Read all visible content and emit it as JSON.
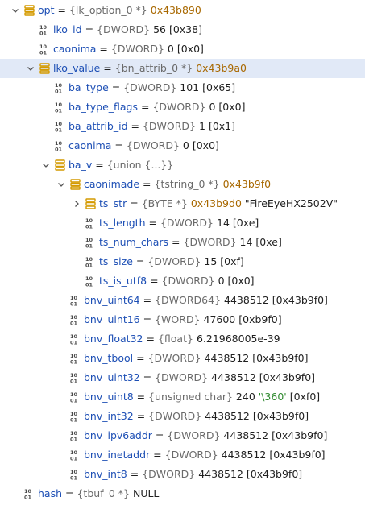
{
  "rows": [
    {
      "id": "opt",
      "name": "opt",
      "type": "{lk_option_0 *}",
      "value": "0x43b890",
      "kind": "struct",
      "expand": "down",
      "value_class": "addr"
    },
    {
      "id": "lko_id",
      "name": "lko_id",
      "type": "{DWORD}",
      "value": "56",
      "hex": "[0x38]",
      "kind": "field"
    },
    {
      "id": "caonima1",
      "name": "caonima",
      "type": "{DWORD}",
      "value": "0",
      "hex": "[0x0]",
      "kind": "field"
    },
    {
      "id": "lko_value",
      "name": "lko_value",
      "type": "{bn_attrib_0 *}",
      "value": "0x43b9a0",
      "kind": "struct",
      "expand": "down",
      "value_class": "addr",
      "selected": true
    },
    {
      "id": "ba_type",
      "name": "ba_type",
      "type": "{DWORD}",
      "value": "101",
      "hex": "[0x65]",
      "kind": "field"
    },
    {
      "id": "ba_type_flags",
      "name": "ba_type_flags",
      "type": "{DWORD}",
      "value": "0",
      "hex": "[0x0]",
      "kind": "field"
    },
    {
      "id": "ba_attrib_id",
      "name": "ba_attrib_id",
      "type": "{DWORD}",
      "value": "1",
      "hex": "[0x1]",
      "kind": "field"
    },
    {
      "id": "caonima2",
      "name": "caonima",
      "type": "{DWORD}",
      "value": "0",
      "hex": "[0x0]",
      "kind": "field"
    },
    {
      "id": "ba_v",
      "name": "ba_v",
      "type": "{union {...}}",
      "value": "",
      "kind": "struct",
      "expand": "down"
    },
    {
      "id": "caonimade",
      "name": "caonimade",
      "type": "{tstring_0 *}",
      "value": "0x43b9f0",
      "kind": "struct",
      "expand": "down",
      "value_class": "addr"
    },
    {
      "id": "ts_str",
      "name": "ts_str",
      "type": "{BYTE *}",
      "value": "0x43b9d0",
      "str": "\"FireEyeHX2502V\"",
      "kind": "struct",
      "expand": "right",
      "value_class": "addr"
    },
    {
      "id": "ts_length",
      "name": "ts_length",
      "type": "{DWORD}",
      "value": "14",
      "hex": "[0xe]",
      "kind": "field"
    },
    {
      "id": "ts_num_chars",
      "name": "ts_num_chars",
      "type": "{DWORD}",
      "value": "14",
      "hex": "[0xe]",
      "kind": "field"
    },
    {
      "id": "ts_size",
      "name": "ts_size",
      "type": "{DWORD}",
      "value": "15",
      "hex": "[0xf]",
      "kind": "field"
    },
    {
      "id": "ts_is_utf8",
      "name": "ts_is_utf8",
      "type": "{DWORD}",
      "value": "0",
      "hex": "[0x0]",
      "kind": "field"
    },
    {
      "id": "bnv_uint64",
      "name": "bnv_uint64",
      "type": "{DWORD64}",
      "value": "4438512",
      "hex": "[0x43b9f0]",
      "kind": "field"
    },
    {
      "id": "bnv_uint16",
      "name": "bnv_uint16",
      "type": "{WORD}",
      "value": "47600",
      "hex": "[0xb9f0]",
      "kind": "field"
    },
    {
      "id": "bnv_float32",
      "name": "bnv_float32",
      "type": "{float}",
      "value": "6.21968005e-39",
      "kind": "field"
    },
    {
      "id": "bnv_tbool",
      "name": "bnv_tbool",
      "type": "{DWORD}",
      "value": "4438512",
      "hex": "[0x43b9f0]",
      "kind": "field"
    },
    {
      "id": "bnv_uint32",
      "name": "bnv_uint32",
      "type": "{DWORD}",
      "value": "4438512",
      "hex": "[0x43b9f0]",
      "kind": "field"
    },
    {
      "id": "bnv_uint8",
      "name": "bnv_uint8",
      "type": "{unsigned char}",
      "value": "240",
      "chr": "'\\360'",
      "hex": "[0xf0]",
      "kind": "field"
    },
    {
      "id": "bnv_int32",
      "name": "bnv_int32",
      "type": "{DWORD}",
      "value": "4438512",
      "hex": "[0x43b9f0]",
      "kind": "field"
    },
    {
      "id": "bnv_ipv6addr",
      "name": "bnv_ipv6addr",
      "type": "{DWORD}",
      "value": "4438512",
      "hex": "[0x43b9f0]",
      "kind": "field"
    },
    {
      "id": "bnv_inetaddr",
      "name": "bnv_inetaddr",
      "type": "{DWORD}",
      "value": "4438512",
      "hex": "[0x43b9f0]",
      "kind": "field"
    },
    {
      "id": "bnv_int8",
      "name": "bnv_int8",
      "type": "{DWORD}",
      "value": "4438512",
      "hex": "[0x43b9f0]",
      "kind": "field"
    },
    {
      "id": "hash",
      "name": "hash",
      "type": "{tbuf_0 *}",
      "value": "NULL",
      "kind": "field"
    }
  ],
  "equals": "=",
  "colors": {
    "name": "#1d4fb5",
    "type": "#6a6a6a",
    "address": "#a86800",
    "char_literal": "#2f8a2f",
    "struct_icon": "#d49a00",
    "field_icon": "#4a4a4a",
    "selected_row": "#e1e9f7"
  },
  "icons": {
    "struct": "struct-icon",
    "field": "numeric-field-icon",
    "expanded": "chevron-down-icon",
    "collapsed": "chevron-right-icon"
  }
}
